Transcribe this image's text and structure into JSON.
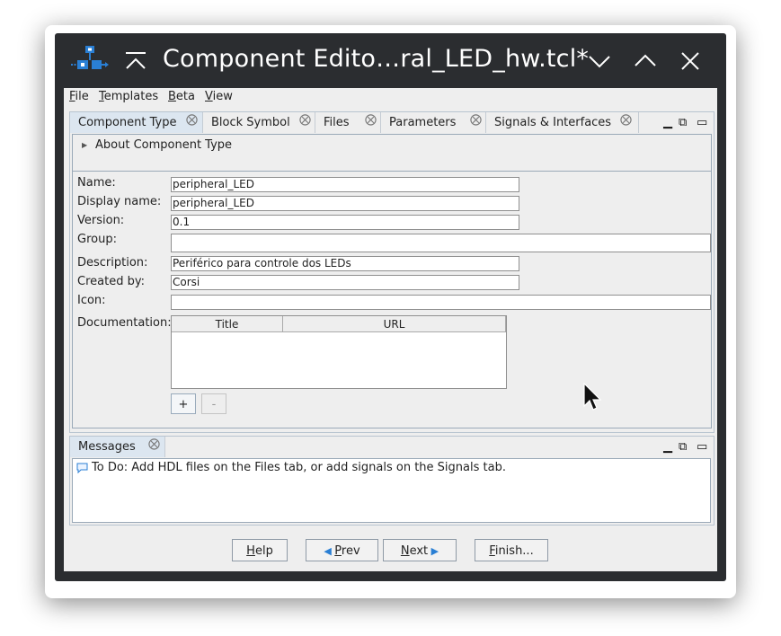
{
  "window": {
    "title": "Component Edito…ral_LED_hw.tcl*"
  },
  "menu": [
    {
      "mnemonic": "F",
      "rest": "ile"
    },
    {
      "mnemonic": "T",
      "rest": "emplates"
    },
    {
      "mnemonic": "B",
      "rest": "eta"
    },
    {
      "mnemonic": "V",
      "rest": "iew"
    }
  ],
  "tabs": [
    {
      "label": "Component Type",
      "active": true
    },
    {
      "label": "Block Symbol",
      "active": false
    },
    {
      "label": "Files",
      "active": false
    },
    {
      "label": "Parameters",
      "active": false
    },
    {
      "label": "Signals & Interfaces",
      "active": false
    }
  ],
  "about": {
    "label": "About Component Type"
  },
  "form": {
    "name_label": "Name:",
    "name_value": "peripheral_LED",
    "display_name_label": "Display name:",
    "display_name_value": "peripheral_LED",
    "version_label": "Version:",
    "version_value": "0.1",
    "group_label": "Group:",
    "group_value": "",
    "description_label": "Description:",
    "description_value": "Periférico para controle dos LEDs",
    "created_by_label": "Created by:",
    "created_by_value": "Corsi",
    "icon_label": "Icon:",
    "icon_value": "",
    "documentation_label": "Documentation:",
    "doc_columns": [
      "Title",
      "URL"
    ],
    "add_label": "+",
    "remove_label": "-"
  },
  "messages": {
    "tab_label": "Messages",
    "text": "To Do: Add HDL files on the Files tab, or add signals on the Signals tab."
  },
  "buttons": {
    "help": {
      "mnemonic": "H",
      "rest": "elp"
    },
    "prev": {
      "mnemonic": "P",
      "rest": "rev"
    },
    "next": {
      "mnemonic": "N",
      "rest": "ext"
    },
    "finish": {
      "mnemonic": "F",
      "rest": "inish..."
    }
  },
  "colors": {
    "titlebar": "#2b2d30",
    "client": "#eeeeee",
    "active_tab": "#dce6f0",
    "accent": "#2a7fd4"
  }
}
